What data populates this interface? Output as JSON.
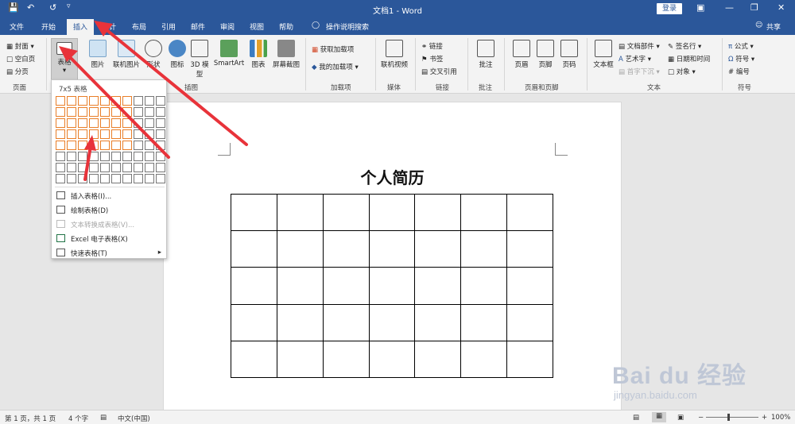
{
  "titlebar": {
    "doc_title": "文档1 - Word",
    "login": "登录",
    "save_icon": "save-icon",
    "undo_icon": "undo-icon",
    "redo_icon": "redo-icon"
  },
  "tabs": [
    "文件",
    "开始",
    "插入",
    "设计",
    "布局",
    "引用",
    "邮件",
    "审阅",
    "视图",
    "帮助"
  ],
  "active_tab": "插入",
  "tell_me": "操作说明搜索",
  "share": "共享",
  "ribbon": {
    "pages": {
      "cover": "封面",
      "blank": "空白页",
      "break": "分页",
      "label": "页面"
    },
    "table": {
      "label": "表格"
    },
    "illustrations": {
      "picture": "图片",
      "online_picture": "联机图片",
      "shapes": "形状",
      "icons": "图标",
      "model3d": "3D 模型",
      "smartart": "SmartArt",
      "chart": "图表",
      "screenshot": "屏幕截图",
      "label": "插图"
    },
    "addins": {
      "get": "获取加载项",
      "my": "我的加载项",
      "label": "加载项"
    },
    "media": {
      "online_video": "联机视频",
      "label": "媒体"
    },
    "links": {
      "link": "链接",
      "bookmark": "书签",
      "cross_ref": "交叉引用",
      "label": "链接"
    },
    "comments": {
      "comment": "批注",
      "label": "批注"
    },
    "header_footer": {
      "header": "页眉",
      "footer": "页脚",
      "page_number": "页码",
      "label": "页眉和页脚"
    },
    "text": {
      "textbox": "文本框",
      "quick_parts": "文档部件",
      "wordart": "艺术字",
      "dropcap": "首字下沉",
      "signature": "签名行",
      "datetime": "日期和时间",
      "object": "对象",
      "label": "文本"
    },
    "symbols": {
      "equation": "公式",
      "symbol": "符号",
      "number": "编号",
      "label": "符号"
    }
  },
  "dropdown": {
    "grid_label": "7x5 表格",
    "grid_cols": 10,
    "grid_rows": 8,
    "highlight_cols": 7,
    "highlight_rows": 5,
    "items": [
      {
        "label": "插入表格(I)...",
        "disabled": false
      },
      {
        "label": "绘制表格(D)",
        "disabled": false
      },
      {
        "label": "文本转换成表格(V)...",
        "disabled": true
      },
      {
        "label": "Excel 电子表格(X)",
        "disabled": false
      },
      {
        "label": "快速表格(T)",
        "disabled": false
      }
    ]
  },
  "document": {
    "heading": "个人简历",
    "table_rows": 5,
    "table_cols": 7
  },
  "statusbar": {
    "page": "第 1 页，共 1 页",
    "words": "4 个字",
    "lang": "中文(中国)",
    "zoom": "100%"
  },
  "watermark": {
    "main": "Bai du 经验",
    "sub": "jingyan.baidu.com"
  },
  "colors": {
    "brand": "#2b579a",
    "highlight": "#e97e28",
    "arrow": "#e8333a"
  }
}
